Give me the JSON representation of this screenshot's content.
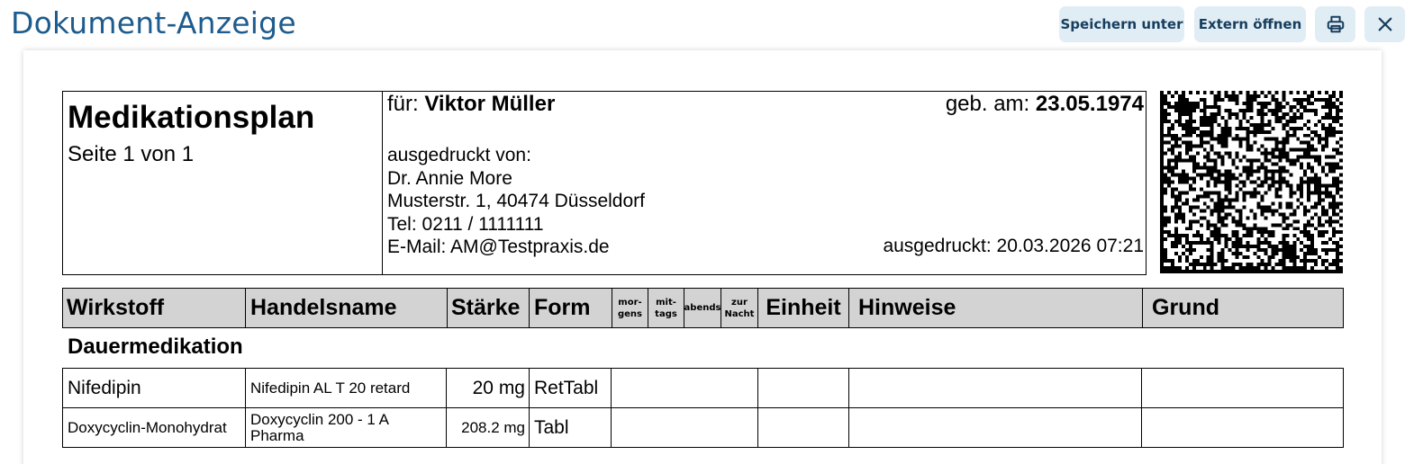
{
  "toolbar": {
    "title": "Dokument-Anzeige",
    "save_as_label": "Speichern unter",
    "open_external_label": "Extern öffnen",
    "print_icon": "printer-icon",
    "close_icon": "close-icon",
    "button_bg": "#e1edf4",
    "title_color": "#1d5c8e"
  },
  "plan": {
    "title": "Medikationsplan",
    "page_info": "Seite 1 von 1",
    "for_label": "für:",
    "patient_name": "Viktor Müller",
    "dob_label": "geb. am:",
    "dob": "23.05.1974",
    "printed_by_label": "ausgedruckt von:",
    "doctor_name": "Dr. Annie More",
    "address": "Musterstr. 1, 40474 Düsseldorf",
    "phone": "Tel: 0211 / 1111111",
    "email": "E-Mail: AM@Testpraxis.de",
    "printed_at": "ausgedruckt: 20.03.2026 07:21"
  },
  "table": {
    "headers": {
      "wirkstoff": "Wirkstoff",
      "handelsname": "Handelsname",
      "staerke": "Stärke",
      "form": "Form",
      "morgens": "mor-\ngens",
      "mittags": "mit-\ntags",
      "abends": "abends",
      "zur_nacht": "zur\nNacht",
      "einheit": "Einheit",
      "hinweise": "Hinweise",
      "grund": "Grund"
    },
    "section_title": "Dauermedikation",
    "rows": [
      {
        "wirkstoff": "Nifedipin",
        "handelsname": "Nifedipin AL T 20 retard",
        "staerke": "20 mg",
        "form": "RetTabl"
      },
      {
        "wirkstoff": "Doxycyclin-Monohydrat",
        "handelsname": "Doxycyclin 200 - 1 A Pharma",
        "staerke": "208.2 mg",
        "form": "Tabl"
      }
    ]
  }
}
